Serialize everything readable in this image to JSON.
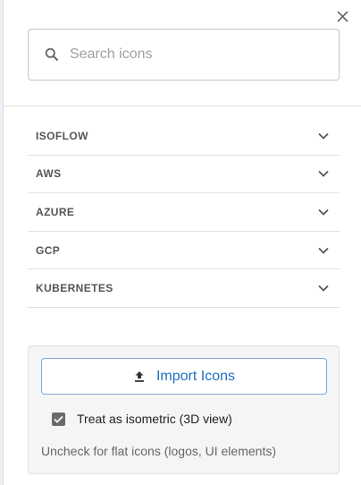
{
  "panel": {
    "close_icon": "close-icon",
    "search": {
      "placeholder": "Search icons",
      "value": "",
      "icon": "search-icon"
    },
    "categories": [
      {
        "label": "ISOFLOW",
        "icon": "chevron-down-icon"
      },
      {
        "label": "AWS",
        "icon": "chevron-down-icon"
      },
      {
        "label": "AZURE",
        "icon": "chevron-down-icon"
      },
      {
        "label": "GCP",
        "icon": "chevron-down-icon"
      },
      {
        "label": "KUBERNETES",
        "icon": "chevron-down-icon"
      }
    ],
    "import": {
      "button_label": "Import Icons",
      "button_icon": "upload-icon",
      "checkbox_label": "Treat as isometric (3D view)",
      "checkbox_checked": true,
      "helper_text": "Uncheck for flat icons (logos, UI elements)"
    }
  },
  "colors": {
    "accent": "#1f6fbf",
    "button_border": "#84a9d6",
    "panel_bg": "#f5f5f5",
    "checkbox_bg": "#6b6b6b"
  }
}
